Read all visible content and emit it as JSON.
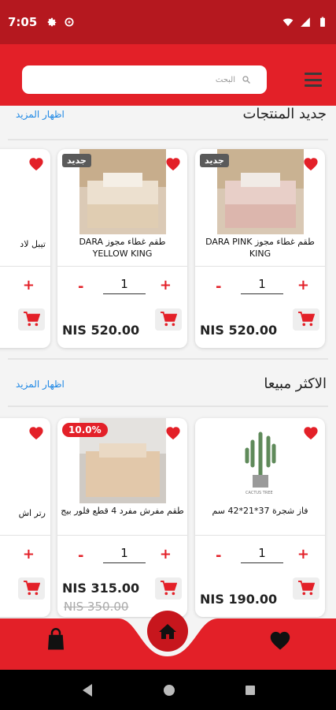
{
  "status_bar": {
    "time": "7:05"
  },
  "header": {
    "search_placeholder": "البحث"
  },
  "sections": {
    "new": {
      "title": "جديد المنتجات",
      "show_more": "اظهار المزيد",
      "products": [
        {
          "name": "طقم غطاء مجوز DARA PINK KING",
          "badge": "جديد",
          "qty": "1",
          "price": "NIS 520.00"
        },
        {
          "name": "طقم غطاء مجوز DARA YELLOW KING",
          "badge": "جديد",
          "qty": "1",
          "price": "NIS 520.00"
        },
        {
          "name": "تيبل لاد"
        }
      ]
    },
    "best": {
      "title": "الاكثر مبيعا",
      "show_more": "اظهار المزيد",
      "products": [
        {
          "name": "فاز شجرة 37*21*42 سم",
          "qty": "1",
          "price": "NIS 190.00",
          "img_caption": "CACTUS TREE"
        },
        {
          "name": "طقم مفرش مفرد 4 قطع فلور بيج",
          "badge": "10.0%",
          "qty": "1",
          "price": "NIS 315.00",
          "old_price": "NIS 350.00"
        },
        {
          "name": "رتر اش"
        }
      ]
    }
  },
  "qty_controls": {
    "minus": "-",
    "plus": "+"
  },
  "colors": {
    "primary": "#e32028",
    "dark_red": "#b5181f",
    "link": "#1e88e5"
  },
  "icons": [
    "menu-icon",
    "search-icon",
    "heart-icon",
    "cart-icon",
    "home-icon",
    "shopping-bag-icon"
  ]
}
